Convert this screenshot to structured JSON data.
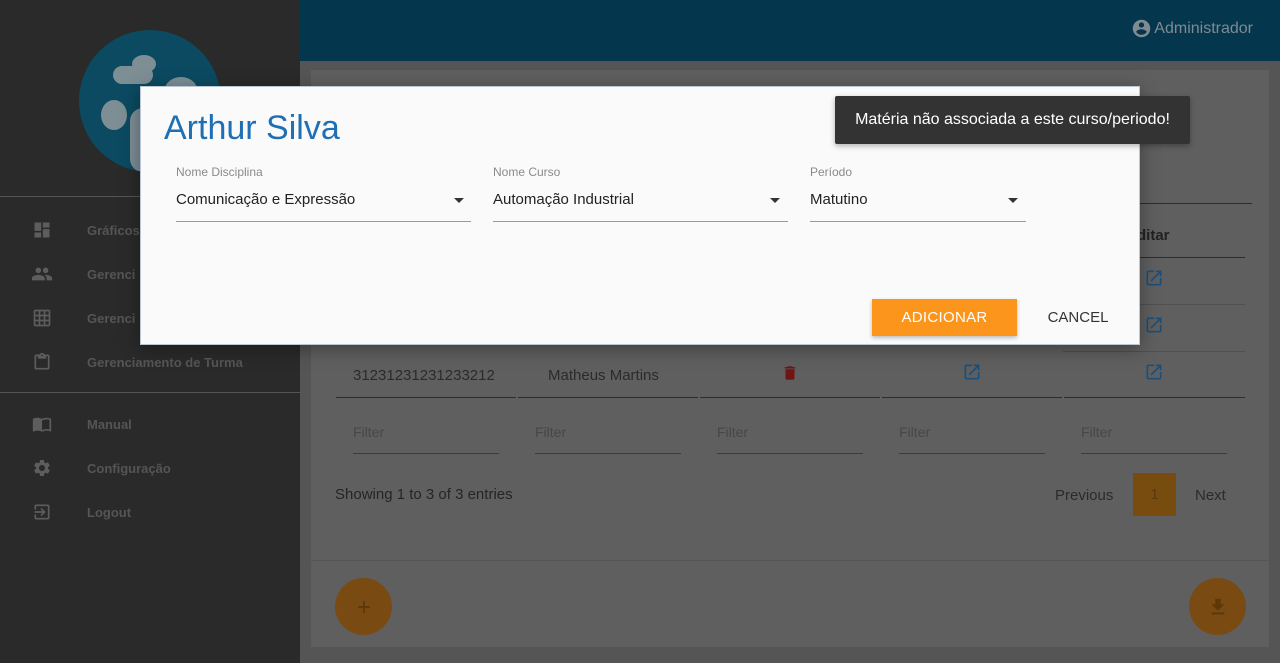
{
  "header": {
    "user_name": "Administrador"
  },
  "sidebar": {
    "items": [
      {
        "label": "Gráficos",
        "icon": "dashboard-icon"
      },
      {
        "label": "Gerenciamento de Alunos",
        "icon": "people-icon"
      },
      {
        "label": "Gerenciamento de Disciplinas",
        "icon": "grid-icon"
      },
      {
        "label": "Gerenciamento de Turma",
        "icon": "clipboard-icon"
      },
      {
        "label": "Manual",
        "icon": "book-icon"
      },
      {
        "label": "Configuração",
        "icon": "gear-icon"
      },
      {
        "label": "Logout",
        "icon": "logout-icon"
      }
    ]
  },
  "table": {
    "edit_header": "ditar",
    "rows": [
      {
        "id": "31231231231233212",
        "name": "Matheus Martins"
      }
    ],
    "filter_placeholder": "Filter",
    "showing": "Showing 1 to 3 of 3 entries",
    "pagination": {
      "previous": "Previous",
      "current": "1",
      "next": "Next"
    }
  },
  "dialog": {
    "title": "Arthur Silva",
    "fields": [
      {
        "label": "Nome Disciplina",
        "value": "Comunicação e Expressão"
      },
      {
        "label": "Nome Curso",
        "value": "Automação Industrial"
      },
      {
        "label": "Período",
        "value": "Matutino"
      }
    ],
    "add_label": "ADICIONAR",
    "cancel_label": "CANCEL"
  },
  "toast": {
    "message": "Matéria não associada a este curso/periodo!"
  },
  "colors": {
    "primary_blue": "#1f6fb5",
    "accent_orange": "#fb951c",
    "danger_red": "#e53935",
    "topbar": "#04364e",
    "sidebar": "#2a2a2a"
  }
}
